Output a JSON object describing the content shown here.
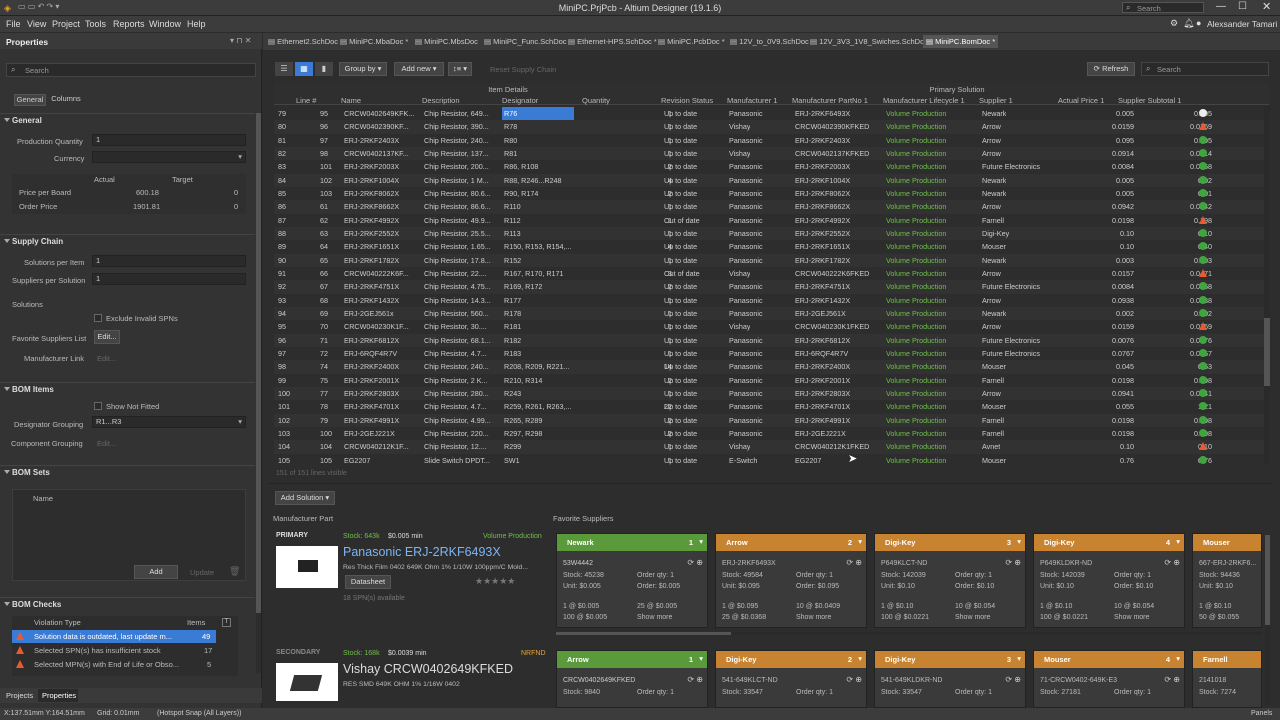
{
  "window": {
    "title": "MiniPC.PrjPcb - Altium Designer (19.1.6)",
    "search": "Search",
    "user": "Alexsander Tamari"
  },
  "menu": [
    "File",
    "View",
    "Project",
    "Tools",
    "Reports",
    "Window",
    "Help"
  ],
  "tabs": [
    "Ethernet2.SchDoc",
    "MiniPC.MbaDoc *",
    "MiniPC.MbsDoc",
    "MiniPC_Func.SchDoc",
    "Ethernet-HPS.SchDoc *",
    "MiniPC.PcbDoc *",
    "12V_to_0V9.SchDoc",
    "12V_3V3_1V8_Swiches.SchDoc",
    "MiniPC.BomDoc *"
  ],
  "props": {
    "title": "Properties",
    "search": "Search",
    "tab_general": "General",
    "tab_columns": "Columns",
    "general": "General",
    "production_qty_label": "Production Quantity",
    "production_qty": "1",
    "currency_label": "Currency",
    "actual": "Actual",
    "target": "Target",
    "price_per_board": "Price per Board",
    "ppb_actual": "600.18",
    "ppb_target": "0",
    "order_price": "Order Price",
    "op_actual": "1901.81",
    "op_target": "0",
    "supply_chain": "Supply Chain",
    "solutions_per_item_label": "Solutions per Item",
    "solutions_per_item": "1",
    "suppliers_per_solution_label": "Suppliers per Solution",
    "suppliers_per_solution": "1",
    "solutions": "Solutions",
    "exclude_invalid": "Exclude Invalid SPNs",
    "fav_suppliers": "Favorite Suppliers List",
    "edit": "Edit...",
    "manufacturer_link": "Manufacturer Link",
    "bom_items": "BOM Items",
    "show_not_fitted": "Show Not Fitted",
    "designator_grouping": "Designator Grouping",
    "designator_grouping_value": "R1...R3",
    "component_grouping": "Component Grouping",
    "bom_sets": "BOM Sets",
    "name_col": "Name",
    "add": "Add",
    "update": "Update",
    "bom_checks": "BOM Checks",
    "violation_type": "Violation Type",
    "items": "Items",
    "checks": [
      {
        "text": "Solution data is outdated, last update m...",
        "count": "49"
      },
      {
        "text": "Selected SPN(s) has insufficient stock",
        "count": "17"
      },
      {
        "text": "Selected MPN(s) with End of Life or Obso...",
        "count": "5"
      }
    ],
    "bottom_tabs": [
      "Projects",
      "Properties"
    ]
  },
  "toolbar": {
    "group_by": "Group by",
    "add_new": "Add new",
    "reset": "Reset Supply Chain",
    "refresh": "Refresh",
    "search": "Search"
  },
  "groups": {
    "item_details": "Item Details",
    "primary_solution": "Primary Solution"
  },
  "columns": [
    "Line #",
    "Name",
    "Description",
    "Designator",
    "Quantity",
    "Revision Status",
    "Manufacturer 1",
    "Manufacturer PartNo 1",
    "Manufacturer Lifecycle 1",
    "Supplier 1",
    "Actual Price 1",
    "Supplier Subtotal 1"
  ],
  "rows": [
    [
      "79",
      "95",
      "CRCW0402649KFK...",
      "Chip Resistor, 649...",
      "R76",
      "1",
      "Up to date",
      "Panasonic",
      "ERJ-2RKF6493X",
      "Volume Production",
      "Newark",
      "0.005",
      "0.005",
      "i"
    ],
    [
      "80",
      "96",
      "CRCW0402390KF...",
      "Chip Resistor, 390...",
      "R78",
      "1",
      "Up to date",
      "Vishay",
      "CRCW0402390KFKED",
      "Volume Production",
      "Arrow",
      "0.0159",
      "0.0159",
      "w"
    ],
    [
      "81",
      "97",
      "ERJ-2RKF2403X",
      "Chip Resistor, 240...",
      "R80",
      "1",
      "Up to date",
      "Panasonic",
      "ERJ-2RKF2403X",
      "Volume Production",
      "Arrow",
      "0.095",
      "0.095",
      "ok"
    ],
    [
      "82",
      "98",
      "CRCW0402137KF...",
      "Chip Resistor, 137...",
      "R81",
      "1",
      "Up to date",
      "Vishay",
      "CRCW0402137KFKED",
      "Volume Production",
      "Arrow",
      "0.0914",
      "0.0914",
      "ok"
    ],
    [
      "83",
      "101",
      "ERJ-2RKF2003X",
      "Chip Resistor, 200...",
      "R86, R108",
      "2",
      "Up to date",
      "Panasonic",
      "ERJ-2RKF2003X",
      "Volume Production",
      "Future Electronics",
      "0.0084",
      "0.0168",
      "ok"
    ],
    [
      "84",
      "102",
      "ERJ-2RKF1004X",
      "Chip Resistor, 1 M...",
      "R88, R246...R248",
      "4",
      "Up to date",
      "Panasonic",
      "ERJ-2RKF1004X",
      "Volume Production",
      "Newark",
      "0.005",
      "0.02",
      "ok"
    ],
    [
      "85",
      "103",
      "ERJ-2RKF8062X",
      "Chip Resistor, 80.6...",
      "R90, R174",
      "2",
      "Up to date",
      "Panasonic",
      "ERJ-2RKF8062X",
      "Volume Production",
      "Newark",
      "0.005",
      "0.01",
      "ok"
    ],
    [
      "86",
      "61",
      "ERJ-2RKF8662X",
      "Chip Resistor, 86.6...",
      "R110",
      "1",
      "Up to date",
      "Panasonic",
      "ERJ-2RKF8662X",
      "Volume Production",
      "Arrow",
      "0.0942",
      "0.0942",
      "ok"
    ],
    [
      "87",
      "62",
      "ERJ-2RKF4992X",
      "Chip Resistor, 49.9...",
      "R112",
      "1",
      "Out of date",
      "Panasonic",
      "ERJ-2RKF4992X",
      "Volume Production",
      "Farnell",
      "0.0198",
      "0.198",
      "w"
    ],
    [
      "88",
      "63",
      "ERJ-2RKF2552X",
      "Chip Resistor, 25.5...",
      "R113",
      "1",
      "Up to date",
      "Panasonic",
      "ERJ-2RKF2552X",
      "Volume Production",
      "Digi-Key",
      "0.10",
      "0.10",
      "ok"
    ],
    [
      "89",
      "64",
      "ERJ-2RKF1651X",
      "Chip Resistor, 1.65...",
      "R150, R153, R154,...",
      "4",
      "Up to date",
      "Panasonic",
      "ERJ-2RKF1651X",
      "Volume Production",
      "Mouser",
      "0.10",
      "0.40",
      "ok"
    ],
    [
      "90",
      "65",
      "ERJ-2RKF1782X",
      "Chip Resistor, 17.8...",
      "R152",
      "1",
      "Up to date",
      "Panasonic",
      "ERJ-2RKF1782X",
      "Volume Production",
      "Newark",
      "0.003",
      "0.003",
      "ok"
    ],
    [
      "91",
      "66",
      "CRCW040222K6F...",
      "Chip Resistor, 22....",
      "R167, R170, R171",
      "3",
      "Out of date",
      "Vishay",
      "CRCW040222K6FKED",
      "Volume Production",
      "Arrow",
      "0.0157",
      "0.0471",
      "w"
    ],
    [
      "92",
      "67",
      "ERJ-2RKF4751X",
      "Chip Resistor, 4.75...",
      "R169, R172",
      "2",
      "Up to date",
      "Panasonic",
      "ERJ-2RKF4751X",
      "Volume Production",
      "Future Electronics",
      "0.0084",
      "0.0168",
      "ok"
    ],
    [
      "93",
      "68",
      "ERJ-2RKF1432X",
      "Chip Resistor, 14.3...",
      "R177",
      "1",
      "Up to date",
      "Panasonic",
      "ERJ-2RKF1432X",
      "Volume Production",
      "Arrow",
      "0.0938",
      "0.0938",
      "ok"
    ],
    [
      "94",
      "69",
      "ERJ-2GEJ561x",
      "Chip Resistor, 560...",
      "R178",
      "1",
      "Up to date",
      "Panasonic",
      "ERJ-2GEJ561X",
      "Volume Production",
      "Newark",
      "0.002",
      "0.002",
      "ok"
    ],
    [
      "95",
      "70",
      "CRCW040230K1F...",
      "Chip Resistor, 30....",
      "R181",
      "1",
      "Up to date",
      "Vishay",
      "CRCW040230K1FKED",
      "Volume Production",
      "Arrow",
      "0.0159",
      "0.0159",
      "w"
    ],
    [
      "96",
      "71",
      "ERJ-2RKF6812X",
      "Chip Resistor, 68.1...",
      "R182",
      "1",
      "Up to date",
      "Panasonic",
      "ERJ-2RKF6812X",
      "Volume Production",
      "Future Electronics",
      "0.0076",
      "0.0076",
      "ok"
    ],
    [
      "97",
      "72",
      "ERJ-6RQF4R7V",
      "Chip Resistor, 4.7...",
      "R183",
      "1",
      "Up to date",
      "Panasonic",
      "ERJ-6RQF4R7V",
      "Volume Production",
      "Future Electronics",
      "0.0767",
      "0.0767",
      "ok"
    ],
    [
      "98",
      "74",
      "ERJ-2RKF2400X",
      "Chip Resistor, 240...",
      "R208, R209, R221...",
      "14",
      "Up to date",
      "Panasonic",
      "ERJ-2RKF2400X",
      "Volume Production",
      "Mouser",
      "0.045",
      "0.63",
      "ok"
    ],
    [
      "99",
      "75",
      "ERJ-2RKF2001X",
      "Chip Resistor, 2 K...",
      "R210, R314",
      "2",
      "Up to date",
      "Panasonic",
      "ERJ-2RKF2001X",
      "Volume Production",
      "Farnell",
      "0.0198",
      "0.198",
      "ok"
    ],
    [
      "100",
      "77",
      "ERJ-2RKF2803X",
      "Chip Resistor, 280...",
      "R243",
      "1",
      "Up to date",
      "Panasonic",
      "ERJ-2RKF2803X",
      "Volume Production",
      "Arrow",
      "0.0941",
      "0.0941",
      "ok"
    ],
    [
      "101",
      "78",
      "ERJ-2RKF4701X",
      "Chip Resistor, 4.7...",
      "R259, R261, R263,...",
      "22",
      "Up to date",
      "Panasonic",
      "ERJ-2RKF4701X",
      "Volume Production",
      "Mouser",
      "0.055",
      "1.21",
      "ok"
    ],
    [
      "102",
      "79",
      "ERJ-2RKF4991X",
      "Chip Resistor, 4.99...",
      "R265, R289",
      "2",
      "Up to date",
      "Panasonic",
      "ERJ-2RKF4991X",
      "Volume Production",
      "Farnell",
      "0.0198",
      "0.198",
      "ok"
    ],
    [
      "103",
      "100",
      "ERJ-2GEJ221X",
      "Chip Resistor, 220...",
      "R297, R298",
      "2",
      "Up to date",
      "Panasonic",
      "ERJ-2GEJ221X",
      "Volume Production",
      "Farnell",
      "0.0198",
      "0.198",
      "ok"
    ],
    [
      "104",
      "104",
      "CRCW040212K1F...",
      "Chip Resistor, 12....",
      "R299",
      "1",
      "Up to date",
      "Vishay",
      "CRCW040212K1FKED",
      "Volume Production",
      "Avnet",
      "0.10",
      "0.10",
      "w"
    ],
    [
      "105",
      "105",
      "EG2207",
      "Slide Switch DPDT...",
      "SW1",
      "1",
      "Up to date",
      "E-Switch",
      "EG2207",
      "Volume Production",
      "Mouser",
      "0.76",
      "0.76",
      "ok"
    ]
  ],
  "lines_visible": "151 of 151 lines visible",
  "solution": {
    "add_solution": "Add Solution",
    "manufacturer_part": "Manufacturer Part",
    "favorite_suppliers": "Favorite Suppliers",
    "primary_label": "PRIMARY",
    "primary_stock": "Stock: 643k",
    "primary_min": "$0.005 min",
    "primary_lifecycle": "Volume Production",
    "primary_name": "Panasonic ERJ-2RKF6493X",
    "primary_desc": "Res Thick Film 0402 649K Ohm 1% 1/10W 100ppm/C Mold...",
    "datasheet": "Datasheet",
    "spn_available": "18 SPN(s) available",
    "secondary_label": "SECONDARY",
    "secondary_stock": "Stock: 168k",
    "secondary_min": "$0.0039 min",
    "secondary_lifecycle": "NRFND",
    "secondary_name": "Vishay CRCW0402649KFKED",
    "secondary_desc": "RES SMD 649K OHM 1% 1/16W 0402"
  },
  "cards_row1": [
    {
      "supplier": "Newark",
      "num": "1",
      "color": "#5a9a3a",
      "spn": "53W4442",
      "stock": "Stock: 45238",
      "unit": "Unit: $0.005",
      "oq": "Order qty: 1",
      "op": "Order: $0.005",
      "p1": "1 @ $0.005",
      "p2": "100 @ $0.005",
      "p3": "25 @ $0.005",
      "more": "Show more"
    },
    {
      "supplier": "Arrow",
      "num": "2",
      "color": "#c88330",
      "spn": "ERJ-2RKF6493X",
      "stock": "Stock: 49584",
      "unit": "Unit: $0.095",
      "oq": "Order qty: 1",
      "op": "Order: $0.095",
      "p1": "1 @ $0.095",
      "p2": "25 @ $0.0368",
      "p3": "10 @ $0.0409",
      "more": "Show more"
    },
    {
      "supplier": "Digi-Key",
      "num": "3",
      "color": "#c88330",
      "spn": "P649KLCT-ND",
      "stock": "Stock: 142039",
      "unit": "Unit: $0.10",
      "oq": "Order qty: 1",
      "op": "Order: $0.10",
      "p1": "1 @ $0.10",
      "p2": "100 @ $0.0221",
      "p3": "10 @ $0.054",
      "more": "Show more"
    },
    {
      "supplier": "Digi-Key",
      "num": "4",
      "color": "#c88330",
      "spn": "P649KLDKR-ND",
      "stock": "Stock: 142039",
      "unit": "Unit: $0.10",
      "oq": "Order qty: 1",
      "op": "Order: $0.10",
      "p1": "1 @ $0.10",
      "p2": "100 @ $0.0221",
      "p3": "10 @ $0.054",
      "more": "Show more"
    },
    {
      "supplier": "Mouser",
      "num": "",
      "color": "#c88330",
      "spn": "667-ERJ-2RKF6...",
      "stock": "Stock: 94436",
      "unit": "Unit: $0.10",
      "oq": "",
      "op": "",
      "p1": "1 @ $0.10",
      "p2": "50 @ $0.055",
      "p3": "",
      "more": ""
    }
  ],
  "cards_row2": [
    {
      "supplier": "Arrow",
      "num": "1",
      "color": "#5a9a3a",
      "spn": "CRCW0402649KFKED",
      "stock": "Stock: 9840",
      "oq": "Order qty: 1"
    },
    {
      "supplier": "Digi-Key",
      "num": "2",
      "color": "#c88330",
      "spn": "541-649KLCT-ND",
      "stock": "Stock: 33547",
      "oq": "Order qty: 1"
    },
    {
      "supplier": "Digi-Key",
      "num": "3",
      "color": "#c88330",
      "spn": "541-649KLDKR-ND",
      "stock": "Stock: 33547",
      "oq": "Order qty: 1"
    },
    {
      "supplier": "Mouser",
      "num": "4",
      "color": "#c88330",
      "spn": "71-CRCW0402-649K-E3",
      "stock": "Stock: 27181",
      "oq": "Order qty: 1"
    },
    {
      "supplier": "Farnell",
      "num": "",
      "color": "#c88330",
      "spn": "2141018",
      "stock": "Stock: 7274",
      "oq": ""
    }
  ],
  "status": {
    "coords": "X:137.51mm Y:164.51mm",
    "grid": "Grid: 0.01mm",
    "snap": "(Hotspot Snap (All Layers))",
    "panels": "Panels"
  }
}
